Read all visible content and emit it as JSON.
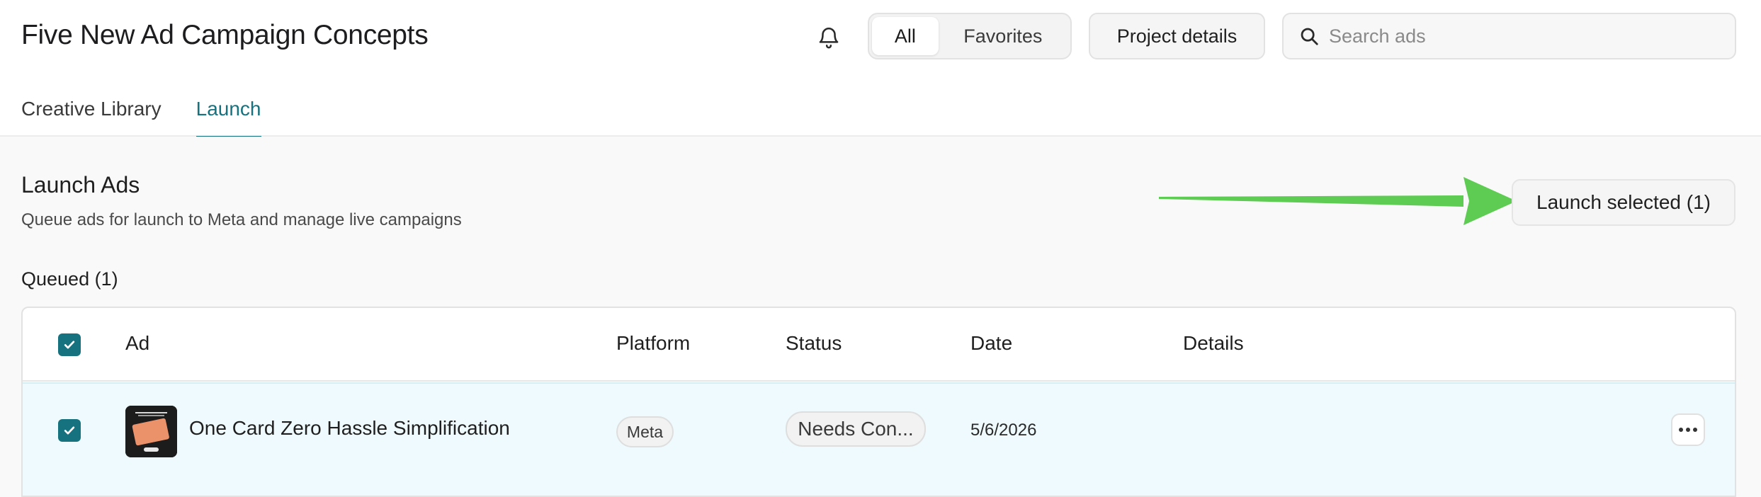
{
  "header": {
    "title": "Five New Ad Campaign Concepts",
    "filter_all": "All",
    "filter_favorites": "Favorites",
    "project_details": "Project details",
    "search_placeholder": "Search ads"
  },
  "tabs": [
    {
      "label": "Creative Library",
      "active": false
    },
    {
      "label": "Launch",
      "active": true
    }
  ],
  "launch": {
    "title": "Launch Ads",
    "subtitle": "Queue ads for launch to Meta and manage live campaigns",
    "launch_button": "Launch selected (1)",
    "queued_label": "Queued (1)"
  },
  "table": {
    "columns": [
      "Ad",
      "Platform",
      "Status",
      "Date",
      "Details"
    ],
    "rows": [
      {
        "checked": true,
        "ad": "One Card Zero Hassle Simplification",
        "platform": "Meta",
        "status": "Needs Con...",
        "date": "5/6/2026",
        "details": ""
      }
    ]
  },
  "icons": {
    "notifications": "bell-icon",
    "search": "search-icon",
    "more": "more-horizontal-icon",
    "annotation": "arrow-annotation"
  },
  "colors": {
    "accent": "#17727f",
    "selected_row": "#eefafd",
    "annotation_arrow": "#5ecb52"
  }
}
